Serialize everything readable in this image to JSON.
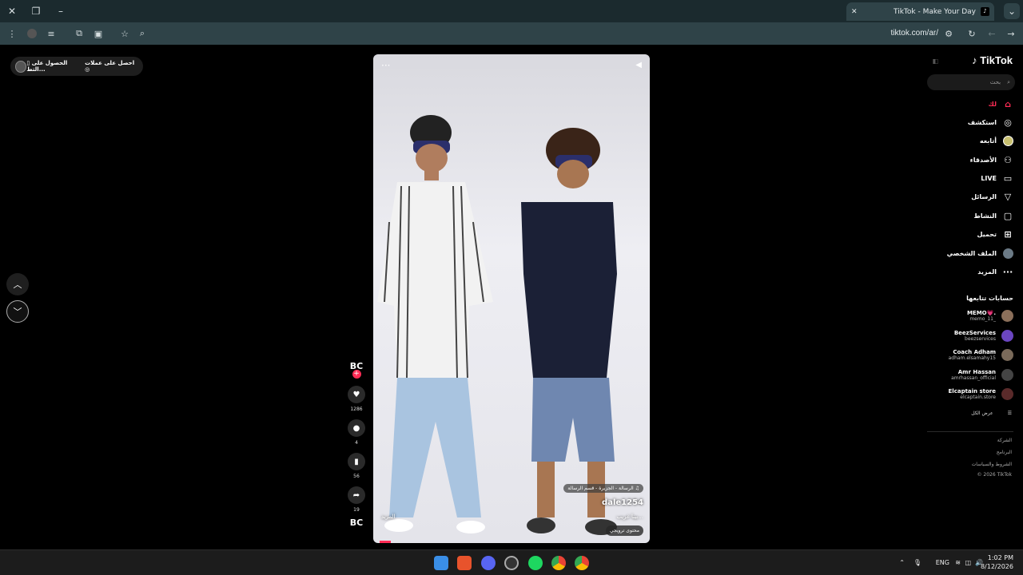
{
  "browser": {
    "tab_title": "TikTok - Make Your Day",
    "url": "tiktok.com/ar/"
  },
  "top_pill": {
    "coins": "احصل على عملات",
    "app": "الحصول على التط..."
  },
  "video": {
    "author": "dale1254",
    "sound": "الرسالة - الجزيرة - قسم الرسالة",
    "description": "بينا غريب...",
    "more": "المزيد",
    "tag": "محتوى ترويجي"
  },
  "actions": {
    "brand": "BC",
    "likes": "1286",
    "comments": "4",
    "saves": "56",
    "shares": "19",
    "brand_bottom": "BC"
  },
  "sidebar": {
    "logo": "TikTok",
    "search_placeholder": "بحث",
    "nav": [
      {
        "label": "لك",
        "icon": "home-icon"
      },
      {
        "label": "استكشف",
        "icon": "compass-icon"
      },
      {
        "label": "أتابعه",
        "icon": "following-avatar-icon"
      },
      {
        "label": "الأصدقاء",
        "icon": "friends-icon"
      },
      {
        "label": "LIVE",
        "icon": "live-icon"
      },
      {
        "label": "الرسائل",
        "icon": "messages-icon"
      },
      {
        "label": "النشاط",
        "icon": "activity-icon"
      },
      {
        "label": "تحميل",
        "icon": "upload-icon"
      },
      {
        "label": "الملف الشخصي",
        "icon": "profile-avatar-icon"
      },
      {
        "label": "المزيد",
        "icon": "more-icon"
      }
    ],
    "following_header": "حسابات تتابعها",
    "following": [
      {
        "name": "MEMO💗.",
        "handle": "memo_11_",
        "color": "#8b6f5a"
      },
      {
        "name": "BeezServices",
        "handle": "beezservices",
        "color": "#6b46c1"
      },
      {
        "name": "Coach Adham",
        "handle": "adham.elsamahy15",
        "color": "#7a6a5a"
      },
      {
        "name": "Amr Hassan",
        "handle": "amrhassan_official",
        "color": "#444444"
      },
      {
        "name": "Elcaptain store",
        "handle": "elcaptain.store",
        "color": "#5a2a2a"
      }
    ],
    "see_all": "عرض الكل",
    "footer": [
      "الشركة",
      "البرنامج",
      "الشروط والسياسات",
      "© 2026 TikTok"
    ]
  },
  "taskbar": {
    "lang": "ENG",
    "time": "1:02 PM",
    "date": "8/12/2026"
  }
}
